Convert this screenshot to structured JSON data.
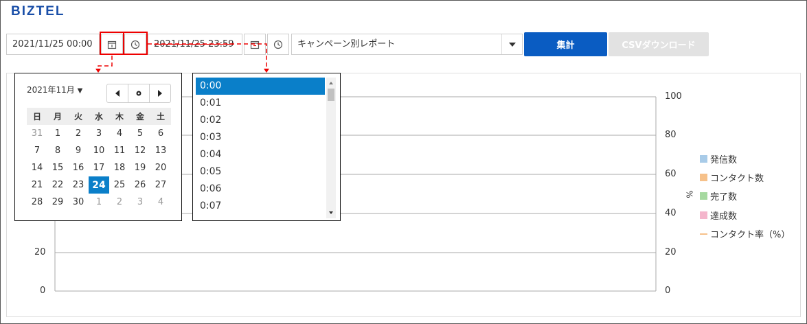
{
  "app": {
    "logo": "BIZTEL"
  },
  "toolbar": {
    "start_datetime": "2021/11/25 00:00",
    "end_datetime": "2021/11/25 23:59",
    "report_type": "キャンペーン別レポート",
    "aggregate_label": "集計",
    "csv_label": "CSVダウンロード",
    "highlight_color": "#e00000"
  },
  "calendar": {
    "month_label": "2021年11月",
    "weekdays": [
      "日",
      "月",
      "火",
      "水",
      "木",
      "金",
      "土"
    ],
    "weeks": [
      [
        "31",
        "1",
        "2",
        "3",
        "4",
        "5",
        "6"
      ],
      [
        "7",
        "8",
        "9",
        "10",
        "11",
        "12",
        "13"
      ],
      [
        "14",
        "15",
        "16",
        "17",
        "18",
        "19",
        "20"
      ],
      [
        "21",
        "22",
        "23",
        "24",
        "25",
        "26",
        "27"
      ],
      [
        "28",
        "29",
        "30",
        "1",
        "2",
        "3",
        "4"
      ]
    ],
    "selected_day": "24",
    "accent_color": "#0a7fc9"
  },
  "time_picker": {
    "options": [
      "0:00",
      "0:01",
      "0:02",
      "0:03",
      "0:04",
      "0:05",
      "0:06",
      "0:07"
    ],
    "selected": "0:00"
  },
  "chart": {
    "left_ticks": [
      "20",
      "0"
    ],
    "right_ticks": [
      "100",
      "80",
      "60",
      "40",
      "20",
      "0"
    ],
    "right_axis_label": "%",
    "legend": [
      {
        "name": "発信数",
        "color": "#a8cbe8",
        "kind": "box"
      },
      {
        "name": "コンタクト数",
        "color": "#f6c18a",
        "kind": "box"
      },
      {
        "name": "完了数",
        "color": "#a6d9a0",
        "kind": "box"
      },
      {
        "name": "達成数",
        "color": "#f4b6cc",
        "kind": "box"
      },
      {
        "name": "コンタクト率（%）",
        "color": "#f6c18a",
        "kind": "line"
      }
    ]
  }
}
